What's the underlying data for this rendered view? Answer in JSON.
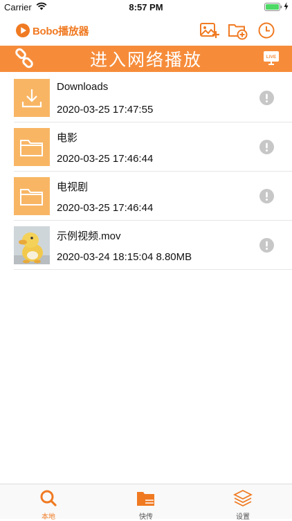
{
  "status_bar": {
    "carrier": "Carrier",
    "time": "8:57 PM"
  },
  "header": {
    "app_name": "Bobo播放器"
  },
  "banner": {
    "title": "进入网络播放",
    "live_badge": "LIVE"
  },
  "files": [
    {
      "name": "Downloads",
      "meta": "2020-03-25 17:47:55",
      "icon": "download-icon"
    },
    {
      "name": "电影",
      "meta": "2020-03-25 17:46:44",
      "icon": "folder-icon"
    },
    {
      "name": "电视剧",
      "meta": "2020-03-25 17:46:44",
      "icon": "folder-icon"
    },
    {
      "name": "示例视频.mov",
      "meta": "2020-03-24 18:15:04 8.80MB",
      "icon": "video-thumbnail"
    }
  ],
  "tabs": [
    {
      "label": "本地",
      "icon": "search-icon",
      "active": true
    },
    {
      "label": "快传",
      "icon": "folder-transfer-icon",
      "active": false
    },
    {
      "label": "设置",
      "icon": "layers-icon",
      "active": false
    }
  ],
  "colors": {
    "accent": "#f07a22",
    "banner": "#f68c3a",
    "thumb": "#f8b665",
    "info": "#c7c7c7"
  }
}
